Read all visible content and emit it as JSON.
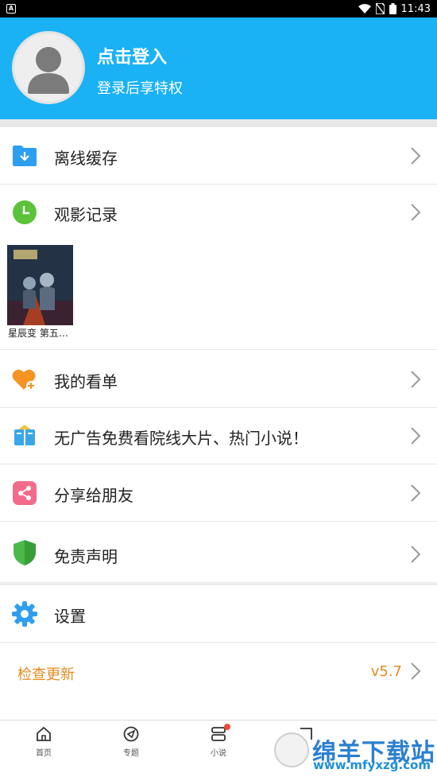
{
  "status_bar": {
    "time": "11:43",
    "badge": "A"
  },
  "header": {
    "login_title": "点击登入",
    "login_subtitle": "登录后享特权"
  },
  "menu": {
    "offline_cache": "离线缓存",
    "watch_history": "观影记录",
    "my_list": "我的看单",
    "ad_free": "无广告免费看院线大片、热门小说！",
    "share": "分享给朋友",
    "disclaimer": "免责声明",
    "settings": "设置"
  },
  "history": {
    "items": [
      {
        "title": "星辰变 第五…"
      }
    ]
  },
  "update": {
    "label": "检查更新",
    "version": "v5.7"
  },
  "tabs": [
    {
      "label": "首页",
      "icon": "home-icon"
    },
    {
      "label": "专题",
      "icon": "compass-icon"
    },
    {
      "label": "小说",
      "icon": "book-icon"
    },
    {
      "label": "",
      "icon": "mine-icon"
    }
  ],
  "watermark": {
    "text": "绵羊下载站",
    "url": "www.mfyxzg.com"
  },
  "colors": {
    "header_bg": "#1ab2f5",
    "accent_orange": "#e58a1f",
    "divider": "#e6e6e6"
  }
}
